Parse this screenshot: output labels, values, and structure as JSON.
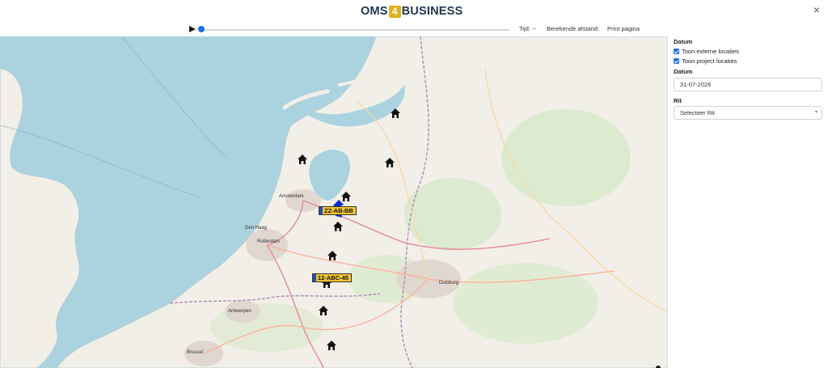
{
  "header": {
    "logo_left": "OMS",
    "logo_mid": "4",
    "logo_right": "BUSINESS",
    "close_glyph": "×"
  },
  "playbar": {
    "play_icon": "play-icon",
    "progress": 0.0,
    "time_text": "Tijd: --",
    "distance_text": "Berekende afstand:",
    "print_label": "Print pagina"
  },
  "map": {
    "provider_style": "OpenStreetMap",
    "sea_color": "#aad3df",
    "land_color": "#f2efe9",
    "places": {
      "amsterdam": "Amsterdam",
      "den_haag": "Den Haag",
      "rotterdam": "Rotterdam",
      "antwerpen": "Antwerpen",
      "brussel": "Brussel",
      "duisburg": "Duisburg"
    },
    "markers": {
      "plate1": "ZZ-AB-BB",
      "plate2": "12-ABC-45"
    }
  },
  "panel": {
    "datum_heading": "Datum",
    "toon_externe": "Toon externe locaties",
    "toon_project": "Toon project locaties",
    "datum_label": "Datum",
    "datum_value": "31-07-2026",
    "rit_label": "Rit",
    "rit_select_value": "Selecteer Rit",
    "accent_color": "#1e6fe0"
  }
}
